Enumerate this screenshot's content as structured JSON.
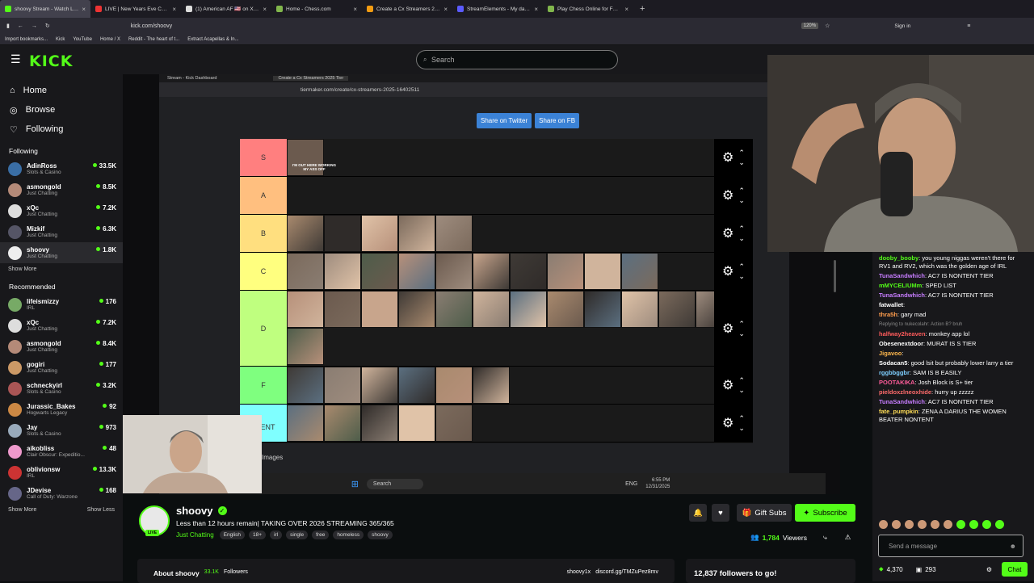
{
  "browser": {
    "tabs": [
      {
        "label": "shoovy Stream - Watch Live",
        "color": "#53fc18",
        "active": true
      },
      {
        "label": "LIVE | New Years Eve Celebration",
        "color": "#e33"
      },
      {
        "label": "(1) American AF 🇺🇸 on X: \"A mu",
        "color": "#ddd"
      },
      {
        "label": "Home - Chess.com",
        "color": "#81b64c"
      },
      {
        "label": "Create a Cx Streamers 2025 Tie",
        "color": "#f39c12"
      },
      {
        "label": "StreamElements - My dashboa",
        "color": "#5b5bff"
      },
      {
        "label": "Play Chess Online for FREE - 2 P",
        "color": "#81b64c"
      }
    ],
    "url": "kick.com/shoovy",
    "zoom": "120%",
    "signin": "Sign in",
    "bookmarks": [
      "Import bookmarks...",
      "Kick",
      "YouTube",
      "Home / X",
      "Reddit - The heart of t...",
      "Extract Acapellas & In..."
    ]
  },
  "header": {
    "logo": "KICK",
    "search_placeholder": "Search"
  },
  "sidebar": {
    "nav": [
      {
        "label": "Home",
        "icon": "home-icon"
      },
      {
        "label": "Browse",
        "icon": "compass-icon"
      },
      {
        "label": "Following",
        "icon": "heart-icon"
      }
    ],
    "following_title": "Following",
    "following": [
      {
        "name": "AdinRoss",
        "cat": "Slots & Casino",
        "count": "33.5K",
        "color": "#3a6ea5"
      },
      {
        "name": "asmongold",
        "cat": "Just Chatting",
        "count": "8.5K",
        "color": "#b48a78"
      },
      {
        "name": "xQc",
        "cat": "Just Chatting",
        "count": "7.2K",
        "color": "#ddd"
      },
      {
        "name": "Mizkif",
        "cat": "Just Chatting",
        "count": "6.3K",
        "color": "#556"
      },
      {
        "name": "shoovy",
        "cat": "Just Chatting",
        "count": "1.8K",
        "color": "#eee"
      }
    ],
    "show_more": "Show More",
    "recommended_title": "Recommended",
    "recommended": [
      {
        "name": "lifeismizzy",
        "cat": "IRL",
        "count": "176",
        "color": "#7a6"
      },
      {
        "name": "xQc",
        "cat": "Just Chatting",
        "count": "7.2K",
        "color": "#ddd"
      },
      {
        "name": "asmongold",
        "cat": "Just Chatting",
        "count": "8.4K",
        "color": "#b48a78"
      },
      {
        "name": "gogiri",
        "cat": "Just Chatting",
        "count": "177",
        "color": "#c96"
      },
      {
        "name": "schneckyirl",
        "cat": "Slots & Casino",
        "count": "3.2K",
        "color": "#a55"
      },
      {
        "name": "Jurassic_Bakes",
        "cat": "Hogwarts Legacy",
        "count": "92",
        "color": "#c84"
      },
      {
        "name": "Jay",
        "cat": "Slots & Casino",
        "count": "973",
        "color": "#9ab"
      },
      {
        "name": "aikobliss",
        "cat": "Clair Obscur: Expeditio...",
        "count": "48",
        "color": "#e9c"
      },
      {
        "name": "oblivionsw",
        "cat": "IRL",
        "count": "13.3K",
        "color": "#c33"
      },
      {
        "name": "JDevise",
        "cat": "Call of Duty: Warzone",
        "count": "168",
        "color": "#668"
      }
    ],
    "show_less": "Show Less"
  },
  "stream": {
    "inner_tabs": [
      "Stream - Kick Dashboard",
      "Create a Cx Streamers 2025 Tier"
    ],
    "inner_url": "tiermaker.com/create/cx-streamers-2025-16402511",
    "share_twitter": "Share on Twitter",
    "share_fb": "Share on FB",
    "images_label": "Images",
    "taskbar_search": "Search",
    "taskbar_lang": "ENG",
    "taskbar_time": "6:55 PM",
    "taskbar_date": "12/31/2025",
    "tiers": [
      {
        "label": "S",
        "color": "#ff7f7f",
        "count": 1,
        "h": 47
      },
      {
        "label": "A",
        "color": "#ffbf7f",
        "count": 0,
        "h": 47
      },
      {
        "label": "B",
        "color": "#ffdf7f",
        "count": 5,
        "h": 47
      },
      {
        "label": "C",
        "color": "#ffff7f",
        "count": 10,
        "h": 47
      },
      {
        "label": "D",
        "color": "#bfff7f",
        "count": 13,
        "h": 94
      },
      {
        "label": "F",
        "color": "#7fff7f",
        "count": 6,
        "h": 47
      },
      {
        "label": "OK / NONTENT",
        "color": "#7fffff",
        "count": 5,
        "h": 47
      }
    ],
    "s_caption": "I'M OUT HERE WORKING MY ASS OFF"
  },
  "channel": {
    "name": "shoovy",
    "live": "LIVE",
    "title": "Less than 12 hours remain| TAKING OVER 2026 STREAMING 365/365",
    "category": "Just Chatting",
    "tags": [
      "English",
      "18+",
      "irl",
      "single",
      "free",
      "homeless",
      "shoovy"
    ],
    "viewers": "1,784",
    "viewers_label": "Viewers",
    "gift_subs": "Gift Subs",
    "subscribe": "Subscribe",
    "about": "About shoovy",
    "followers": "33.1K",
    "followers_label": "Followers",
    "social_x": "shoovy1x",
    "discord": "discord.gg/TMZuPez8mv",
    "goal": "12,837 followers to go!"
  },
  "chat": {
    "messages": [
      {
        "user": "dooby_booby",
        "color": "#53fc18",
        "text": "you young niggas weren't there for RV1 and RV2, which was the golden age of IRL"
      },
      {
        "user": "TunaSandwhich",
        "color": "#c77dff",
        "text": "AC7 IS NONTENT TIER"
      },
      {
        "user": "mMYCELIUMm",
        "color": "#53fc18",
        "text": "SPED LIST"
      },
      {
        "user": "TunaSandwhich",
        "color": "#c77dff",
        "text": "AC7 IS NONTENT TIER"
      },
      {
        "user": "fatwallet",
        "color": "#fff",
        "text": ""
      },
      {
        "user": "thra5h",
        "color": "#ff9d4d",
        "text": "gary mad"
      },
      {
        "user": "halfway2heaven",
        "color": "#ff5c5c",
        "text": "monkey app lol",
        "reply": "Replying to nukecolahr: Action B? bruh"
      },
      {
        "user": "Obesenextdoor",
        "color": "#fff",
        "text": "MURAT IS S TIER"
      },
      {
        "user": "Jigavoo",
        "color": "#ffb84d",
        "text": ""
      },
      {
        "user": "Sodacan5",
        "color": "#fff",
        "text": "good lsit but probably lower larry a tier"
      },
      {
        "user": "rggbbggbr",
        "color": "#7ecfff",
        "text": "SAM IS B EASILY"
      },
      {
        "user": "POOTAKIKA",
        "color": "#ff5c9a",
        "text": "Josh Block is S+ tier"
      },
      {
        "user": "pieldoxzlneoxhide",
        "color": "#ff6b6b",
        "text": "hurry up zzzzz"
      },
      {
        "user": "TunaSandwhich",
        "color": "#c77dff",
        "text": "AC7 IS NONTENT TIER"
      },
      {
        "user": "fate_pumpkin",
        "color": "#ffdd57",
        "text": "ZENA A DARIUS THE WOMEN BEATER NONTENT"
      }
    ],
    "input_placeholder": "Send a message",
    "points": "4,370",
    "subs": "293",
    "chat_button": "Chat"
  }
}
